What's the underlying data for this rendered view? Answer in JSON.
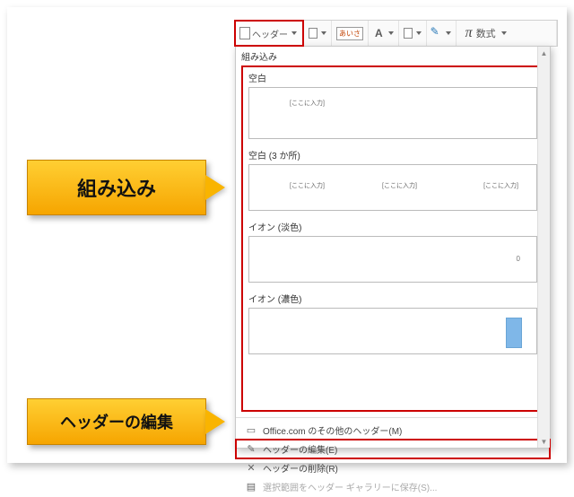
{
  "toolbar": {
    "header_button_label": "ヘッダー",
    "aisa_label": "あいさ",
    "A_label": "A",
    "pi_label": "π",
    "equation_label": "数式"
  },
  "dropdown": {
    "section_title": "組み込み",
    "items": [
      {
        "label": "空白",
        "placeholders": [
          "[ここに入力]"
        ]
      },
      {
        "label": "空白 (3 か所)",
        "placeholders": [
          "[ここに入力]",
          "[ここに入力]",
          "[ここに入力]"
        ]
      },
      {
        "label": "イオン (淡色)",
        "value_hint": "0"
      },
      {
        "label": "イオン (濃色)"
      }
    ],
    "menu": {
      "more_from_office": "Office.com のその他のヘッダー(M)",
      "edit_header": "ヘッダーの編集(E)",
      "remove_header": "ヘッダーの削除(R)",
      "save_selection": "選択範囲をヘッダー ギャラリーに保存(S)..."
    }
  },
  "callouts": {
    "builtin": "組み込み",
    "edit_header": "ヘッダーの編集"
  }
}
